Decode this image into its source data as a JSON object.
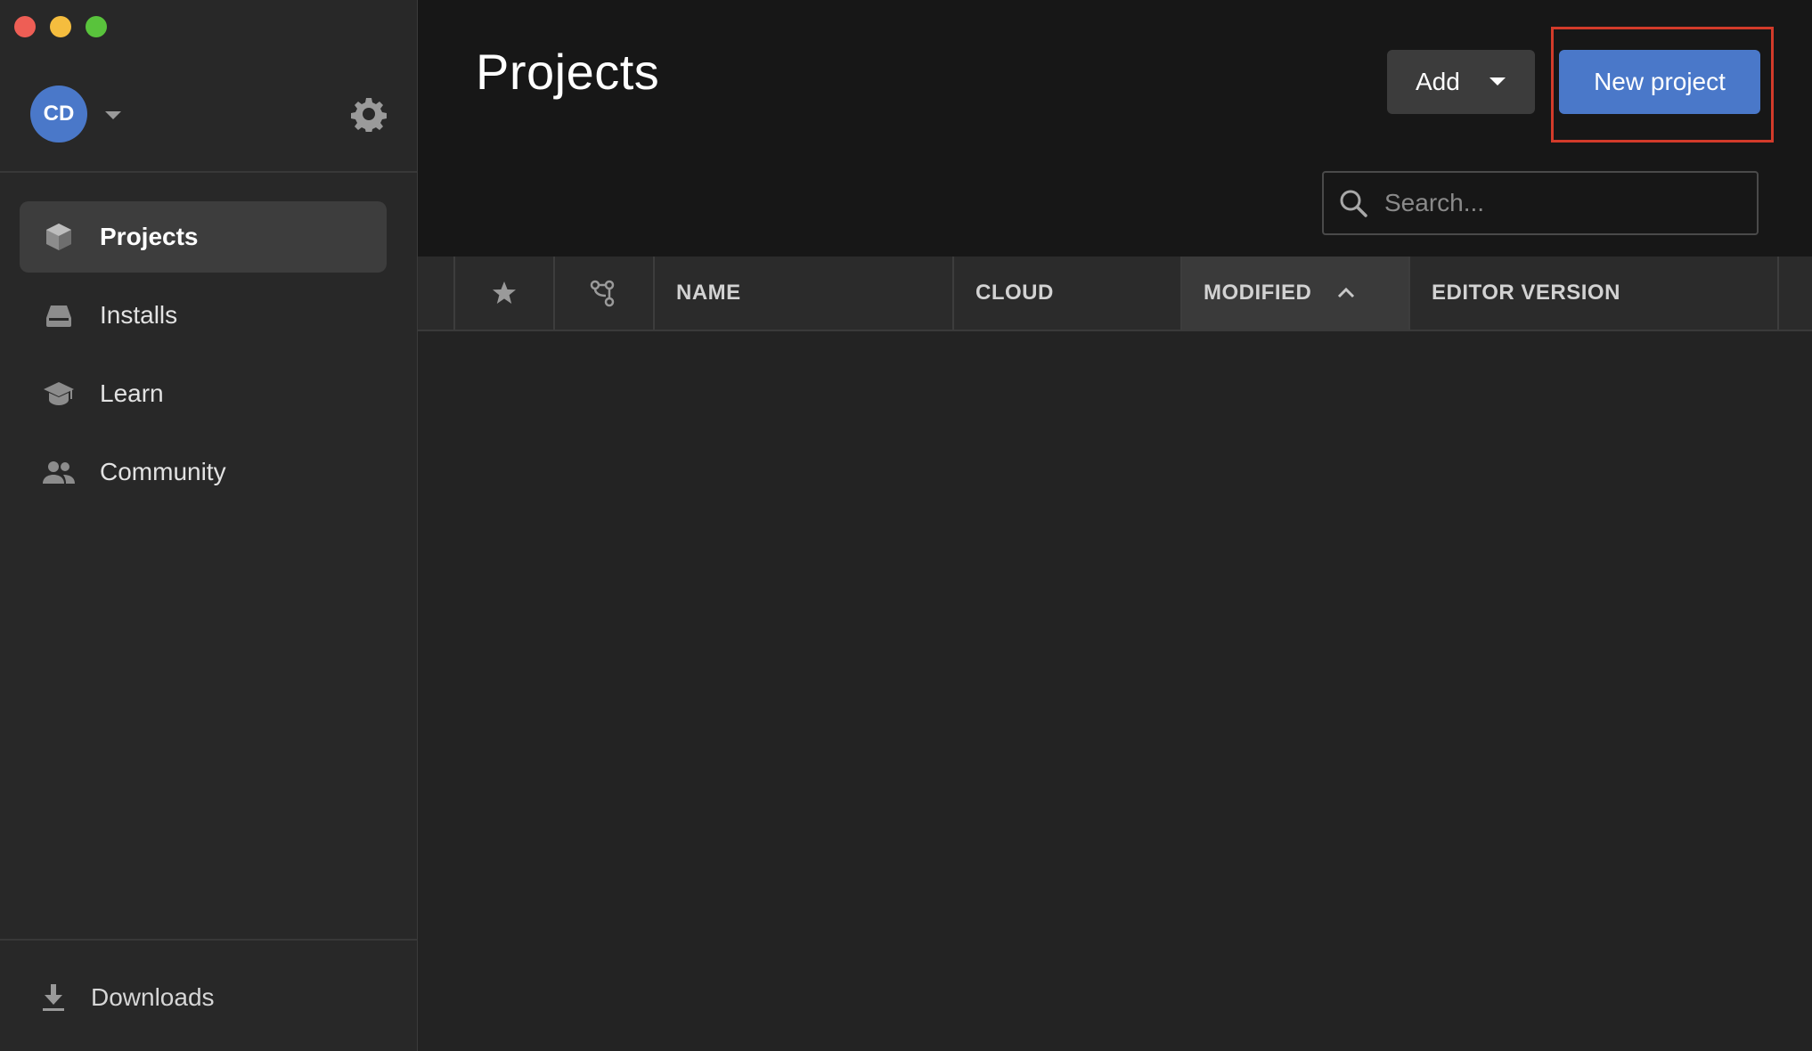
{
  "sidebar": {
    "account": {
      "initials": "CD"
    },
    "nav": [
      {
        "label": "Projects",
        "icon": "cube-icon",
        "active": true
      },
      {
        "label": "Installs",
        "icon": "hard-drive-icon",
        "active": false
      },
      {
        "label": "Learn",
        "icon": "graduation-cap-icon",
        "active": false
      },
      {
        "label": "Community",
        "icon": "people-icon",
        "active": false
      }
    ],
    "downloads_label": "Downloads"
  },
  "header": {
    "title": "Projects",
    "add_label": "Add",
    "new_project_label": "New project"
  },
  "search": {
    "placeholder": "Search...",
    "value": ""
  },
  "table": {
    "columns": [
      "NAME",
      "CLOUD",
      "MODIFIED",
      "EDITOR VERSION"
    ],
    "sorted_column": "MODIFIED",
    "sort_direction": "ascending",
    "rows": []
  },
  "colors": {
    "accent": "#4a78c9",
    "highlight": "#d33b2a",
    "sidebar_bg": "#282828",
    "header_bg": "#171717"
  }
}
